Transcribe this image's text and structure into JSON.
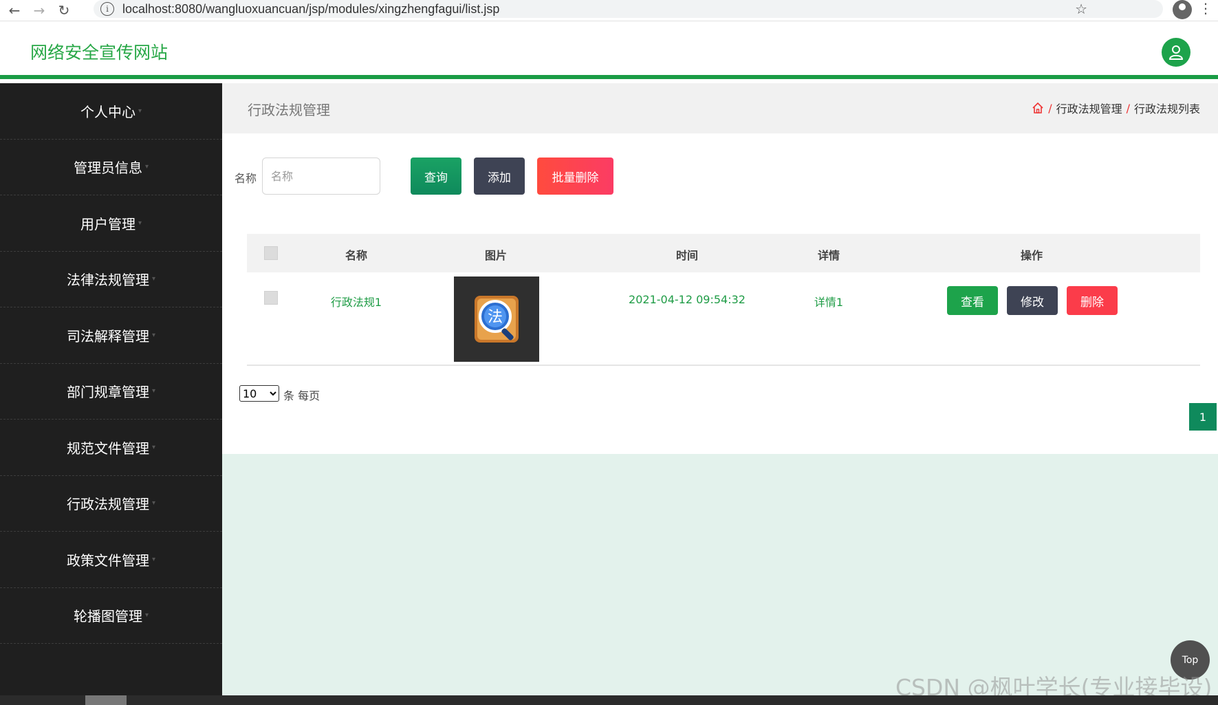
{
  "browser": {
    "url": "localhost:8080/wangluoxuancuan/jsp/modules/xingzhengfagui/list.jsp"
  },
  "header": {
    "site_title": "网络安全宣传网站"
  },
  "sidebar": {
    "items": [
      {
        "label": "个人中心"
      },
      {
        "label": "管理员信息"
      },
      {
        "label": "用户管理"
      },
      {
        "label": "法律法规管理"
      },
      {
        "label": "司法解释管理"
      },
      {
        "label": "部门规章管理"
      },
      {
        "label": "规范文件管理"
      },
      {
        "label": "行政法规管理"
      },
      {
        "label": "政策文件管理"
      },
      {
        "label": "轮播图管理"
      }
    ]
  },
  "main": {
    "page_title": "行政法规管理",
    "breadcrumb": [
      "行政法规管理",
      "行政法规列表"
    ],
    "search": {
      "label": "名称",
      "placeholder": "名称"
    },
    "buttons": {
      "query": "查询",
      "add": "添加",
      "batch_delete": "批量删除"
    },
    "table": {
      "headers": [
        "名称",
        "图片",
        "时间",
        "详情",
        "操作"
      ],
      "rows": [
        {
          "name": "行政法规1",
          "time": "2021-04-12 09:54:32",
          "detail": "详情1",
          "actions": {
            "view": "查看",
            "edit": "修改",
            "delete": "删除"
          }
        }
      ]
    },
    "pagination": {
      "page_size": "10",
      "page_size_label": "条 每页",
      "current_page": "1"
    }
  },
  "top_button": "Top",
  "watermark": "CSDN @枫叶学长(专业接毕设)",
  "colors": {
    "brand_green": "#1a9c45",
    "sidebar_bg": "#1f1f1f",
    "danger": "#fb3c4a",
    "dark_btn": "#3e4354"
  }
}
